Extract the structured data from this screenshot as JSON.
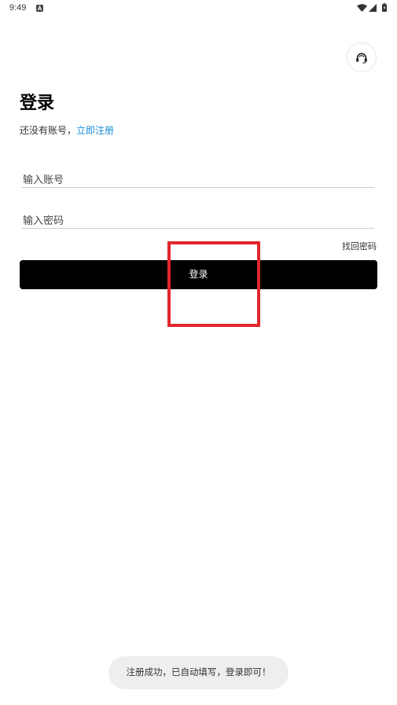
{
  "status_bar": {
    "time": "9:49",
    "left_icons": [
      "notification-a-icon"
    ],
    "right_icons": [
      "wifi-icon",
      "signal-icon",
      "battery-icon"
    ]
  },
  "header": {
    "action_icon": "headset-icon"
  },
  "login": {
    "title": "登录",
    "no_account_text": "还没有账号，",
    "register_link": "立即注册",
    "account": {
      "placeholder": "输入账号",
      "value": ""
    },
    "password": {
      "placeholder": "输入密码",
      "value": ""
    },
    "forgot_password": "找回密码",
    "submit_label": "登录"
  },
  "toast": {
    "message": "注册成功，已自动填写，登录即可！"
  },
  "colors": {
    "accent": "#1a8fd7",
    "button_bg": "#000000",
    "highlight": "#e1262c",
    "toast_bg": "#eeeeee",
    "text": "#222222"
  }
}
